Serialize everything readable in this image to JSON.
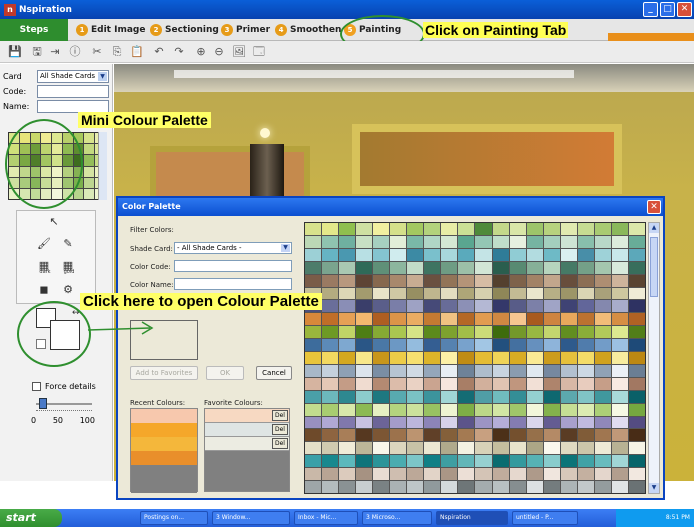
{
  "window": {
    "title": "Nspiration",
    "app_letter": "n"
  },
  "tabs": {
    "steps": "Steps",
    "items": [
      {
        "num": "1",
        "label": "Edit Image"
      },
      {
        "num": "2",
        "label": "Sectioning"
      },
      {
        "num": "3",
        "label": "Primer"
      },
      {
        "num": "4",
        "label": "Smoothen"
      },
      {
        "num": "5",
        "label": "Painting"
      }
    ]
  },
  "logo": {
    "letter": "n",
    "text": "spiration"
  },
  "annotations": {
    "tab": "Click on Painting Tab",
    "mini": "Mini Colour Palette",
    "open": "Click here to open Colour Palette"
  },
  "left": {
    "card_label": "Card",
    "card_value": "All Shade Cards",
    "code_label": "Code:",
    "name_label": "Name:",
    "force_details": "Force details",
    "slider_labels": [
      "0",
      "50",
      "100"
    ],
    "tool_sub_1": "dark",
    "tool_sub_2": "gold",
    "mini_colors": [
      "#d9e58a",
      "#e8e47a",
      "#c9d86a",
      "#f0ec92",
      "#dde890",
      "#b8cf6a",
      "#a7c85c",
      "#d7e38c",
      "#e9eeb0",
      "#cfe07a",
      "#9fc055",
      "#6e9d3a",
      "#bdd46f",
      "#e4ea9a",
      "#8fbb52",
      "#5e8d2f",
      "#c3d980",
      "#dce79c",
      "#b3cf70",
      "#7aa843",
      "#4f7e2a",
      "#a2c561",
      "#d0e18a",
      "#6a9a3a",
      "#3e6d1e",
      "#94bd5a",
      "#c8dd88",
      "#e2ebb0",
      "#c0d78c",
      "#9ec46a",
      "#dbe8a6",
      "#f0f4c8",
      "#b4d07e",
      "#85b253",
      "#d5e4a2",
      "#ecf2c2",
      "#cde0a0",
      "#a9cb7c",
      "#87b65a",
      "#c7dc98",
      "#e6efbc",
      "#9fc570",
      "#7bb04c",
      "#bdd690",
      "#dfebb6",
      "#eaf2c8",
      "#d6e7b0",
      "#c1db98",
      "#e1edc0",
      "#f3f8dc",
      "#cfe3a8",
      "#b6d48c",
      "#dae9b8",
      "#eef5d2"
    ]
  },
  "dialog": {
    "title": "Color Palette",
    "filter_label": "Filter Colors:",
    "shade_label": "Shade Card:",
    "shade_value": "- All Shade Cards -",
    "code_label": "Color Code:",
    "name_label": "Color Name:",
    "add_fav": "Add to Favorites",
    "ok": "OK",
    "cancel": "Cancel",
    "recent_label": "Recent Colours:",
    "fav_label": "Favorite Colours:",
    "del": "Del",
    "recent_colors": [
      "#f7c8ad",
      "#f5a72a",
      "#f4b73b",
      "#e98f2b",
      "#808080",
      "#808080"
    ],
    "fav_colors": [
      "#f7d9c2",
      "#dfe5e4",
      "#ecece2"
    ],
    "palette_rows": [
      [
        "#d8e28c",
        "#e4e88a",
        "#8fbf4f",
        "#cfe0a2",
        "#f1f0a0",
        "#d5e08a",
        "#a3c860",
        "#b3d27c",
        "#e8eda6",
        "#cbe095",
        "#4f8a3a",
        "#c4d88a",
        "#d9e6a8",
        "#9dc46a",
        "#b7d27e",
        "#e1eab0",
        "#c6dc92",
        "#a9cb72",
        "#8ab85b",
        "#dce8aa"
      ],
      [
        "#bcd8b6",
        "#8fc4b0",
        "#6fb0a0",
        "#c8e0c4",
        "#a6d0c0",
        "#e2eed8",
        "#7ab8a8",
        "#b0d6c6",
        "#d4e8d4",
        "#5aa690",
        "#94c6b4",
        "#c0ddca",
        "#e6f0e0",
        "#76b4a2",
        "#a4cfbe",
        "#cde4d4",
        "#88bfac",
        "#b8d8c8",
        "#dcecdc",
        "#68ac98"
      ],
      [
        "#9cd0d6",
        "#66b4c4",
        "#4a98b0",
        "#b8e0e4",
        "#84c4d0",
        "#d0ecee",
        "#3c8aa4",
        "#7ac0cc",
        "#a8d8dc",
        "#5aaabc",
        "#c4e4e6",
        "#2f7c98",
        "#90ccd4",
        "#b2dce0",
        "#6ebac6",
        "#daf0f0",
        "#488ea8",
        "#9ed2d8",
        "#c8e8ea",
        "#5ca8ba"
      ],
      [
        "#4d7c6a",
        "#7aa48e",
        "#a9c8b2",
        "#2f6a58",
        "#5f9078",
        "#8cb69e",
        "#c2dcc8",
        "#3e7462",
        "#6e9c84",
        "#9cc0a8",
        "#d2e6d6",
        "#2a5e4e",
        "#588a72",
        "#86b098",
        "#b6d4be",
        "#467a66",
        "#74a088",
        "#a4c6ae",
        "#d8eadc",
        "#386e5c"
      ],
      [
        "#7a5c48",
        "#9a7a62",
        "#b8987e",
        "#5e4434",
        "#86684e",
        "#a8886c",
        "#c8ac92",
        "#6a5040",
        "#927458",
        "#b49478",
        "#d6bca4",
        "#54402e",
        "#7e624a",
        "#a28266",
        "#c2a68c",
        "#684e3c",
        "#8c6e54",
        "#ae8e72",
        "#ceb49c",
        "#5a4432"
      ],
      [
        "#c9c29c",
        "#b3ab80",
        "#ddd7b6",
        "#a39b6e",
        "#e9e4c8",
        "#cfc8a4",
        "#978f62",
        "#bfb68e",
        "#e3ddc0",
        "#aea678",
        "#d6d0ae",
        "#8f8758",
        "#c3bb94",
        "#eae6cc",
        "#b7af86",
        "#9d9568",
        "#dbd5b4",
        "#a9a17a",
        "#cec79f",
        "#f0ecd6"
      ],
      [
        "#4b4f7c",
        "#6a6e9a",
        "#8a8eb6",
        "#3a3e6a",
        "#5a5e8a",
        "#7a7ea8",
        "#9ea2c4",
        "#464a78",
        "#686c98",
        "#8c90b6",
        "#b4b8d4",
        "#34386a",
        "#585c88",
        "#7c80a8",
        "#a0a4c6",
        "#3f4374",
        "#62669a",
        "#8488ae",
        "#a8acca",
        "#2e3262"
      ],
      [
        "#d8883a",
        "#c06e28",
        "#e6a055",
        "#f4b86e",
        "#ae5e22",
        "#dc9448",
        "#eaac62",
        "#c47a32",
        "#f0c282",
        "#b46826",
        "#e29c50",
        "#d08842",
        "#f6c690",
        "#a85a1e",
        "#ce8440",
        "#e8a85c",
        "#bc7230",
        "#f2bc78",
        "#d68e44",
        "#b06224"
      ],
      [
        "#9ab63c",
        "#6e9a24",
        "#c0d466",
        "#4e7e14",
        "#86aa34",
        "#aac650",
        "#d6e486",
        "#5c8a1c",
        "#7ea22e",
        "#a2be48",
        "#ccdc78",
        "#3e6c0c",
        "#74982a",
        "#98b842",
        "#c4d66e",
        "#628e20",
        "#8aae38",
        "#b2ca5a",
        "#dce890",
        "#527e18"
      ],
      [
        "#3d6c9c",
        "#5c8ab8",
        "#7ea8d0",
        "#2a5686",
        "#4a78a6",
        "#6c98c4",
        "#94bcde",
        "#345e92",
        "#5682b0",
        "#78a2cc",
        "#a2c6e4",
        "#22507e",
        "#4470a0",
        "#6690be",
        "#8eb4da",
        "#2e5a8c",
        "#507cac",
        "#729cc8",
        "#9cc0e2",
        "#1e4a78"
      ],
      [
        "#e8c43a",
        "#f2d860",
        "#d4a820",
        "#f8e88a",
        "#c8961a",
        "#eccc48",
        "#f6e070",
        "#dcb42a",
        "#fcf0a6",
        "#c08c14",
        "#e4bc34",
        "#f0d458",
        "#d8ac24",
        "#faea94",
        "#cc9c1c",
        "#e6c03c",
        "#f4dc68",
        "#d0a21e",
        "#f8ec9e",
        "#bc8812"
      ],
      [
        "#a8b8c8",
        "#c4d0dc",
        "#8ea0b4",
        "#dce4ec",
        "#7a8ea4",
        "#b6c4d2",
        "#d0dae4",
        "#94a6ba",
        "#e8eef4",
        "#6e8298",
        "#aebdcc",
        "#c8d4e0",
        "#8a9cb0",
        "#e0e8f0",
        "#7688a0",
        "#b2c0d0",
        "#ccd8e4",
        "#90a2b6",
        "#ecf0f6",
        "#6a7e94"
      ],
      [
        "#d6b4a0",
        "#e4c8b6",
        "#c49c86",
        "#f0dcd0",
        "#b48a72",
        "#dcbcaa",
        "#ead2c4",
        "#caa490",
        "#f6e6de",
        "#a87e66",
        "#d2b09c",
        "#e0c4b2",
        "#c0967e",
        "#f2e0d6",
        "#ae846c",
        "#d8b8a6",
        "#e8ccbe",
        "#c69e88",
        "#f8eae2",
        "#a27862"
      ],
      [
        "#4a9fa8",
        "#6cb8bc",
        "#2e8890",
        "#8ccccc",
        "#1e7880",
        "#58aab0",
        "#7ac2c4",
        "#3c949c",
        "#a0d6d6",
        "#146c74",
        "#509ea6",
        "#70bcbe",
        "#348e96",
        "#94d0d0",
        "#0e6870",
        "#5ca8ae",
        "#80c4c6",
        "#40989e",
        "#a8dada",
        "#0a6068"
      ],
      [
        "#c2dc8e",
        "#a8cc70",
        "#d8e8aa",
        "#8cba54",
        "#e6f0c2",
        "#b4d47e",
        "#cce29c",
        "#98c262",
        "#eef4d2",
        "#7eae46",
        "#bcd888",
        "#d2e6a4",
        "#a0c66a",
        "#f2f6da",
        "#84b24c",
        "#c6de94",
        "#dcecb2",
        "#acd076",
        "#f6f9e4",
        "#76a840"
      ],
      [
        "#9890c0",
        "#b0a8d4",
        "#8078ac",
        "#c8c2e2",
        "#6c6498",
        "#a49cca",
        "#bcb6dc",
        "#8c84b8",
        "#d6d2ea",
        "#5c548a",
        "#9c94c4",
        "#b4aed8",
        "#847cb2",
        "#dad6ec",
        "#645c92",
        "#a8a0cc",
        "#c0bae0",
        "#9088ba",
        "#e0dcf0",
        "#544c82"
      ],
      [
        "#6e4a2a",
        "#8e6440",
        "#a87e58",
        "#563820",
        "#7c5634",
        "#9c724c",
        "#bc9470",
        "#604028",
        "#84603a",
        "#a47a52",
        "#c8a080",
        "#4c3018",
        "#74502e",
        "#96704a",
        "#b48a66",
        "#5a3c24",
        "#805c38",
        "#a07650",
        "#c09878",
        "#482c16"
      ],
      [
        "#e4e0c8",
        "#d0cab0",
        "#f0ecd8",
        "#bcb698",
        "#f8f6ea",
        "#dcd6be",
        "#c8c2a6",
        "#ece8d2",
        "#b0aa8c",
        "#f4f2e2",
        "#d8d2b8",
        "#c4be9e",
        "#e8e4cc",
        "#aca686",
        "#faf8ee",
        "#e0dac2",
        "#ccc6aa",
        "#eeead6",
        "#b8b294",
        "#f6f4e6"
      ],
      [
        "#3aa0a8",
        "#18888e",
        "#5cb8bc",
        "#0e747a",
        "#2c9499",
        "#4aacb0",
        "#7cc6c8",
        "#108086",
        "#3e9ea2",
        "#62b6b8",
        "#96d0d0",
        "#0a6c70",
        "#349a9e",
        "#56b2b4",
        "#88cccc",
        "#0c7478",
        "#40a2a6",
        "#68bcbe",
        "#a0d6d6",
        "#06646a"
      ],
      [
        "#c9b8a8",
        "#b8a494",
        "#dccbbd",
        "#a69282",
        "#e8dcd2",
        "#cfbeb0",
        "#bca898",
        "#e2d4c8",
        "#aa9686",
        "#ecdfd6",
        "#d4c4b6",
        "#c0ac9c",
        "#e6d8ce",
        "#ae9a8a",
        "#f0e6de",
        "#d8c8ba",
        "#c4b0a0",
        "#e4d6cc",
        "#b29e8e",
        "#f2e8e0"
      ],
      [
        "#9ea6a8",
        "#b4bcbe",
        "#8a9294",
        "#c8ced0",
        "#7a8284",
        "#aab2b4",
        "#bec6c8",
        "#909a9c",
        "#d4dadc",
        "#6e7678",
        "#a4acae",
        "#b8c0c2",
        "#868e90",
        "#dce0e2",
        "#747c7e",
        "#acb4b6",
        "#c2c8ca",
        "#949c9e",
        "#e0e4e6",
        "#6a7274"
      ]
    ]
  },
  "taskbar": {
    "start": "start",
    "items": [
      "Postings on...",
      "3 Window...",
      "Inbox - Mic...",
      "3 Microso...",
      "Nspiration",
      "untitled - P..."
    ],
    "clock": "8:51 PM"
  }
}
